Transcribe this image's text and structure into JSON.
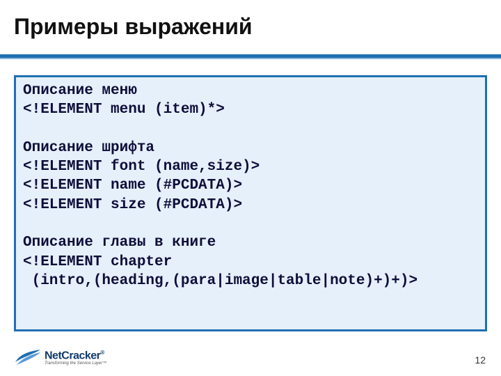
{
  "title": "Примеры выражений",
  "code": {
    "label1": "Описание меню",
    "line1": "<!ELEMENT menu (item)*>",
    "blank1": "",
    "label2": "Описание шрифта",
    "line2a": "<!ELEMENT font (name,size)>",
    "line2b": "<!ELEMENT name (#PCDATA)>",
    "line2c": "<!ELEMENT size (#PCDATA)>",
    "blank2": "",
    "label3": "Описание главы в книге",
    "line3a": "<!ELEMENT chapter",
    "line3b": " (intro,(heading,(para|image|table|note)+)+)>"
  },
  "page_number": "12",
  "logo": {
    "brand": "NetCracker",
    "reg": "®",
    "tagline": "Transforming the Service Layer™"
  }
}
